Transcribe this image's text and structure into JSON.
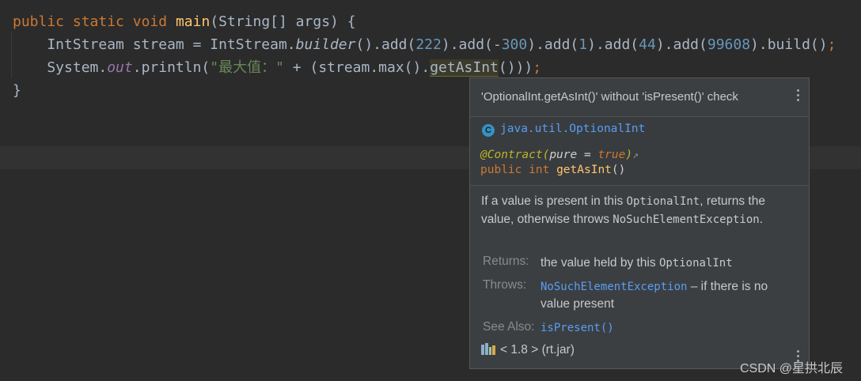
{
  "editor": {
    "line1": {
      "kw1": "public",
      "kw2": "static",
      "kw3": "void",
      "method": "main",
      "rest": "(String[] args) {"
    },
    "line2": {
      "p1": "    IntStream stream = IntStream.",
      "builder": "builder",
      "p2": "().add(",
      "n1": "222",
      "p3": ").add(-",
      "n2": "300",
      "p4": ").add(",
      "n3": "1",
      "p5": ").add(",
      "n4": "44",
      "p6": ").add(",
      "n5": "99608",
      "p7": ").build()",
      "semi": ";"
    },
    "line3": {
      "p1": "    System.",
      "out": "out",
      "p2": ".println(",
      "str": "\"最大值：\"",
      "p3": " + (stream.max().",
      "warn": "getAsInt",
      "p4": "()))",
      "semi": ";"
    },
    "line4": "}"
  },
  "popup": {
    "title": "'OptionalInt.getAsInt()' without 'isPresent()' check",
    "class_icon": "C",
    "class_name": "java.util.OptionalInt",
    "annotation": "@Contract",
    "annotation_open": "(",
    "annotation_param": "pure",
    "annotation_eq": " = ",
    "annotation_value": "true",
    "annotation_close": ")",
    "decl_public": "public",
    "decl_int": "int",
    "decl_method": "getAsInt",
    "decl_parens": "()",
    "desc_1": "If a value is present in this ",
    "desc_code_1": "OptionalInt",
    "desc_2": ", returns the value, otherwise throws ",
    "desc_code_2": "NoSuchElementException",
    "desc_3": ".",
    "returns_label": "Returns:",
    "returns_text": "the value held by this ",
    "returns_code": "OptionalInt",
    "throws_label": "Throws:",
    "throws_link": "NoSuchElementException",
    "throws_text": " – if there is no value present",
    "seealso_label": "See Also:",
    "seealso_link": "isPresent()",
    "library": "< 1.8 > (rt.jar)"
  },
  "watermark": "CSDN @星拱北辰",
  "icons": {
    "menu": "vertical-ellipsis-icon",
    "class": "class-c-icon",
    "external": "external-link-arrow-icon",
    "library": "library-icon"
  },
  "colors": {
    "background": "#2b2b2b",
    "keyword": "#cc7832",
    "method": "#ffc66d",
    "number": "#6897bb",
    "string": "#6a8759",
    "field": "#9876aa",
    "link": "#589df6",
    "annotation": "#bbb529",
    "popup_bg": "#3c3f41"
  }
}
